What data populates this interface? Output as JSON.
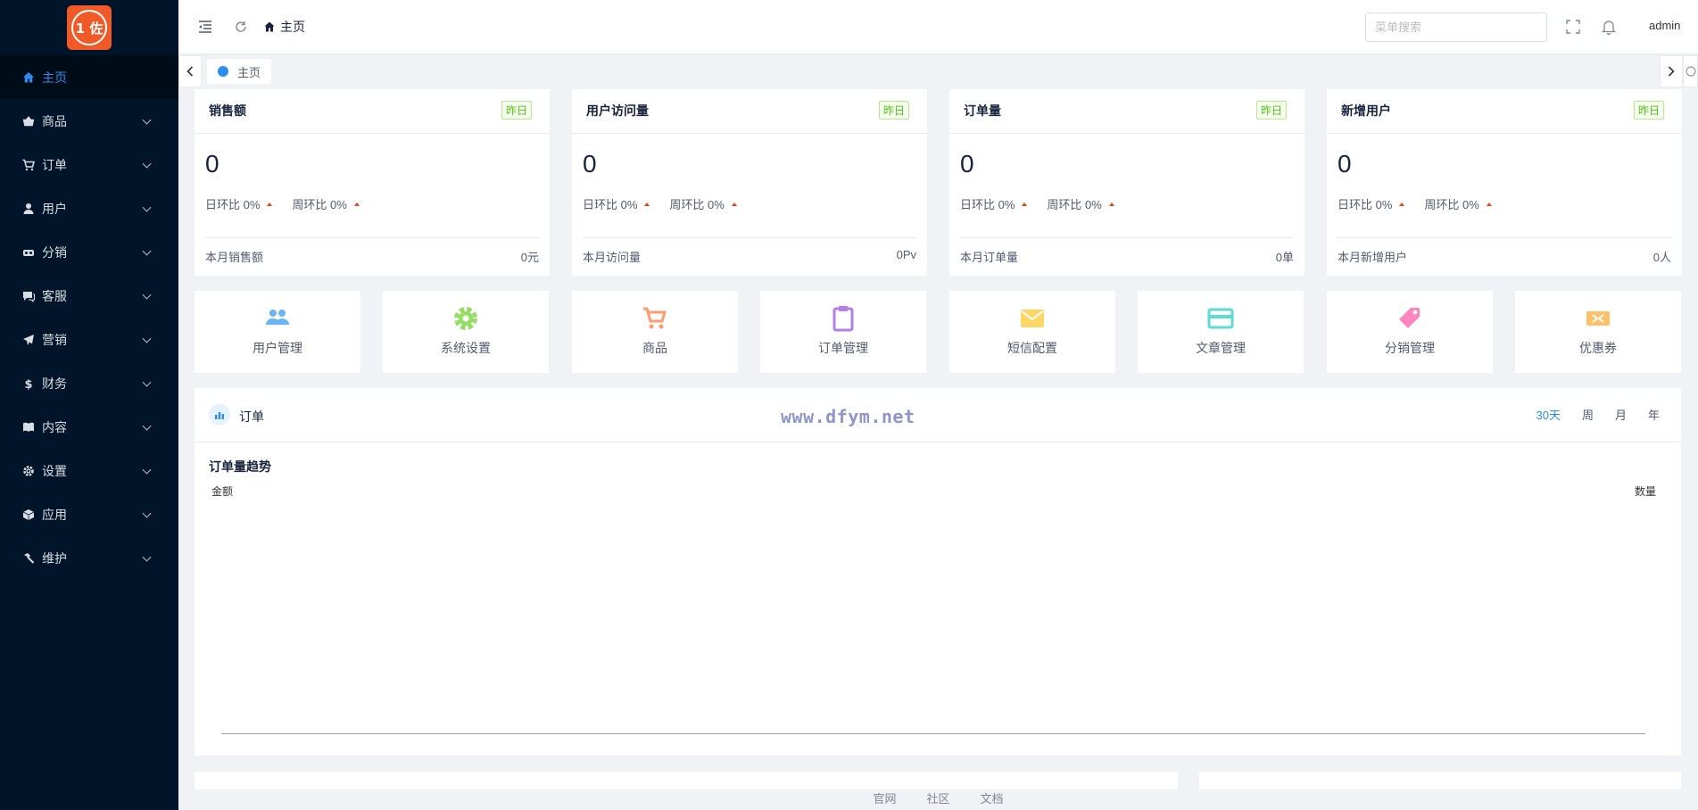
{
  "brand": {
    "logo_text": "1 佐"
  },
  "sidebar": {
    "items": [
      {
        "label": "主页",
        "icon": "home-icon"
      },
      {
        "label": "商品",
        "icon": "basket-icon"
      },
      {
        "label": "订单",
        "icon": "cart-icon"
      },
      {
        "label": "用户",
        "icon": "user-icon"
      },
      {
        "label": "分销",
        "icon": "share-icon"
      },
      {
        "label": "客服",
        "icon": "chat-icon"
      },
      {
        "label": "营销",
        "icon": "send-icon"
      },
      {
        "label": "财务",
        "icon": "dollar-icon"
      },
      {
        "label": "内容",
        "icon": "book-icon"
      },
      {
        "label": "设置",
        "icon": "gear-icon"
      },
      {
        "label": "应用",
        "icon": "cube-icon"
      },
      {
        "label": "维护",
        "icon": "hammer-icon"
      }
    ]
  },
  "header": {
    "breadcrumb": "主页",
    "search_placeholder": "菜单搜索",
    "user": "admin"
  },
  "tabs": [
    {
      "label": "主页"
    }
  ],
  "stats": [
    {
      "title": "销售额",
      "tag": "昨日",
      "value": "0",
      "day_label": "日环比 0%",
      "week_label": "周环比 0%",
      "foot_label": "本月销售额",
      "foot_value": "0元"
    },
    {
      "title": "用户访问量",
      "tag": "昨日",
      "value": "0",
      "day_label": "日环比 0%",
      "week_label": "周环比 0%",
      "foot_label": "本月访问量",
      "foot_value": "0Pv"
    },
    {
      "title": "订单量",
      "tag": "昨日",
      "value": "0",
      "day_label": "日环比 0%",
      "week_label": "周环比 0%",
      "foot_label": "本月订单量",
      "foot_value": "0单"
    },
    {
      "title": "新增用户",
      "tag": "昨日",
      "value": "0",
      "day_label": "日环比 0%",
      "week_label": "周环比 0%",
      "foot_label": "本月新增用户",
      "foot_value": "0人"
    }
  ],
  "quick_nav": [
    {
      "label": "用户管理",
      "icon": "users-icon",
      "color": "#69b4f4"
    },
    {
      "label": "系统设置",
      "icon": "gear-icon",
      "color": "#95de64"
    },
    {
      "label": "商品",
      "icon": "cart-icon",
      "color": "#ff9c6e"
    },
    {
      "label": "订单管理",
      "icon": "clipboard-icon",
      "color": "#b37feb"
    },
    {
      "label": "短信配置",
      "icon": "mail-icon",
      "color": "#ffd666"
    },
    {
      "label": "文章管理",
      "icon": "card-icon",
      "color": "#5cdbd3"
    },
    {
      "label": "分销管理",
      "icon": "tag-icon",
      "color": "#ff85c0"
    },
    {
      "label": "优惠券",
      "icon": "coupon-icon",
      "color": "#ffc069"
    }
  ],
  "order_panel": {
    "title": "订单",
    "watermark": "www.dfym.net",
    "periods": [
      "30天",
      "周",
      "月",
      "年"
    ],
    "active_period": "30天",
    "chart_title": "订单量趋势",
    "left_axis": "金额",
    "right_axis": "数量"
  },
  "footer": {
    "links": [
      "官网",
      "社区",
      "文档"
    ]
  }
}
